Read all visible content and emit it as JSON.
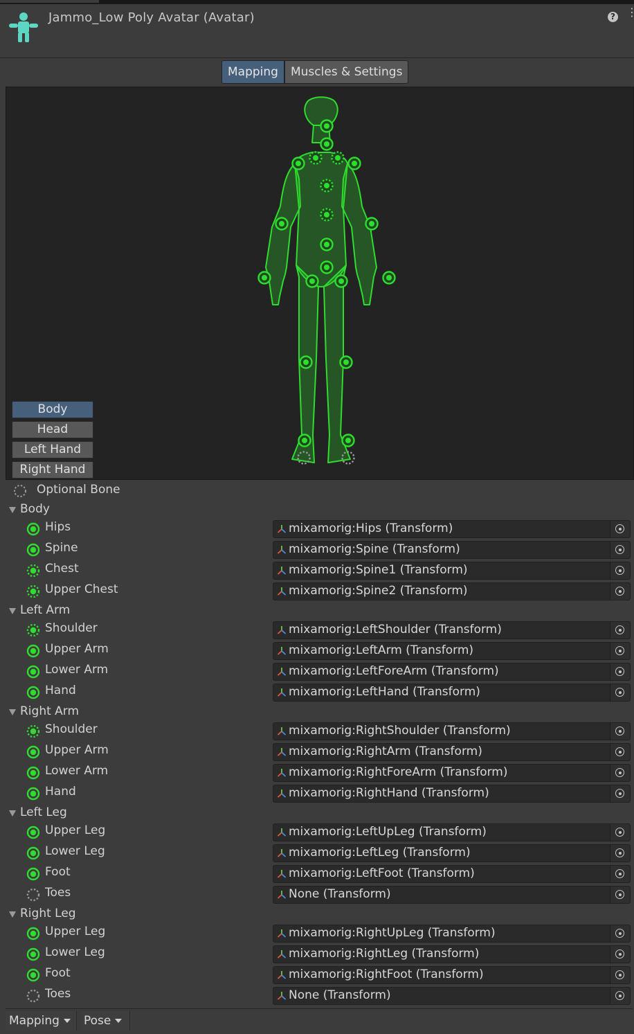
{
  "header": {
    "title": "Jammo_Low Poly Avatar (Avatar)",
    "help_icon": "help-icon",
    "menu_icon": "more-icon",
    "accent": "#5ed6c4"
  },
  "tabs": [
    {
      "label": "Mapping",
      "active": true
    },
    {
      "label": "Muscles & Settings",
      "active": false
    }
  ],
  "body_parts": [
    {
      "label": "Body",
      "active": true
    },
    {
      "label": "Head"
    },
    {
      "label": "Left Hand"
    },
    {
      "label": "Right Hand"
    }
  ],
  "colors": {
    "bone_green": "#2fdc2f",
    "active_blue": "#46607c"
  },
  "optional_label": "Optional Bone",
  "groups": [
    {
      "label": "Body",
      "bones": [
        {
          "label": "Hips",
          "value": "mixamorig:Hips (Transform)",
          "required": true
        },
        {
          "label": "Spine",
          "value": "mixamorig:Spine (Transform)",
          "required": true
        },
        {
          "label": "Chest",
          "value": "mixamorig:Spine1 (Transform)",
          "required": false
        },
        {
          "label": "Upper Chest",
          "value": "mixamorig:Spine2 (Transform)",
          "required": false
        }
      ]
    },
    {
      "label": "Left Arm",
      "bones": [
        {
          "label": "Shoulder",
          "value": "mixamorig:LeftShoulder (Transform)",
          "required": false
        },
        {
          "label": "Upper Arm",
          "value": "mixamorig:LeftArm (Transform)",
          "required": true
        },
        {
          "label": "Lower Arm",
          "value": "mixamorig:LeftForeArm (Transform)",
          "required": true
        },
        {
          "label": "Hand",
          "value": "mixamorig:LeftHand (Transform)",
          "required": true
        }
      ]
    },
    {
      "label": "Right Arm",
      "bones": [
        {
          "label": "Shoulder",
          "value": "mixamorig:RightShoulder (Transform)",
          "required": false
        },
        {
          "label": "Upper Arm",
          "value": "mixamorig:RightArm (Transform)",
          "required": true
        },
        {
          "label": "Lower Arm",
          "value": "mixamorig:RightForeArm (Transform)",
          "required": true
        },
        {
          "label": "Hand",
          "value": "mixamorig:RightHand (Transform)",
          "required": true
        }
      ]
    },
    {
      "label": "Left Leg",
      "bones": [
        {
          "label": "Upper Leg",
          "value": "mixamorig:LeftUpLeg (Transform)",
          "required": true
        },
        {
          "label": "Lower Leg",
          "value": "mixamorig:LeftLeg (Transform)",
          "required": true
        },
        {
          "label": "Foot",
          "value": "mixamorig:LeftFoot (Transform)",
          "required": true
        },
        {
          "label": "Toes",
          "value": "None (Transform)",
          "required": false,
          "empty": true
        }
      ]
    },
    {
      "label": "Right Leg",
      "bones": [
        {
          "label": "Upper Leg",
          "value": "mixamorig:RightUpLeg (Transform)",
          "required": true
        },
        {
          "label": "Lower Leg",
          "value": "mixamorig:RightLeg (Transform)",
          "required": true
        },
        {
          "label": "Foot",
          "value": "mixamorig:RightFoot (Transform)",
          "required": true
        },
        {
          "label": "Toes",
          "value": "None (Transform)",
          "required": false,
          "empty": true
        }
      ]
    }
  ],
  "footer": {
    "mapping_label": "Mapping",
    "pose_label": "Pose"
  }
}
